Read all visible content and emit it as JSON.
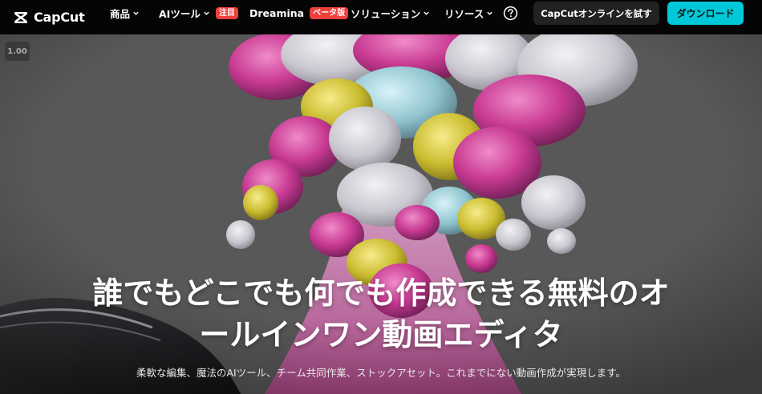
{
  "nav": {
    "logo_text": "CapCut",
    "items": [
      {
        "label": "商品",
        "has_chevron": true
      },
      {
        "label": "AIツール",
        "has_chevron": true,
        "badge": "注目"
      },
      {
        "label": "Dreamina",
        "has_chevron": false,
        "badge": "ベータ版"
      },
      {
        "label": "ソリューション",
        "has_chevron": true
      },
      {
        "label": "リソース",
        "has_chevron": true
      }
    ],
    "help_icon": "question-circle-icon",
    "try_online_label": "CapCutオンラインを試す",
    "download_label": "ダウンロード"
  },
  "hero": {
    "zoom_label": "1.00",
    "headline_line1": "誰でもどこでも何でも作成できる無料のオ",
    "headline_line2": "ールインワン動画エディタ",
    "subline": "柔軟な編集、魔法のAIツール、チーム共同作業、ストックアセット。これまでにない動画作成が実現します。"
  },
  "colors": {
    "nav_bg": "#050505",
    "accent": "#00c8d8",
    "badge": "#f0403c",
    "hero_bg": "#585858"
  }
}
